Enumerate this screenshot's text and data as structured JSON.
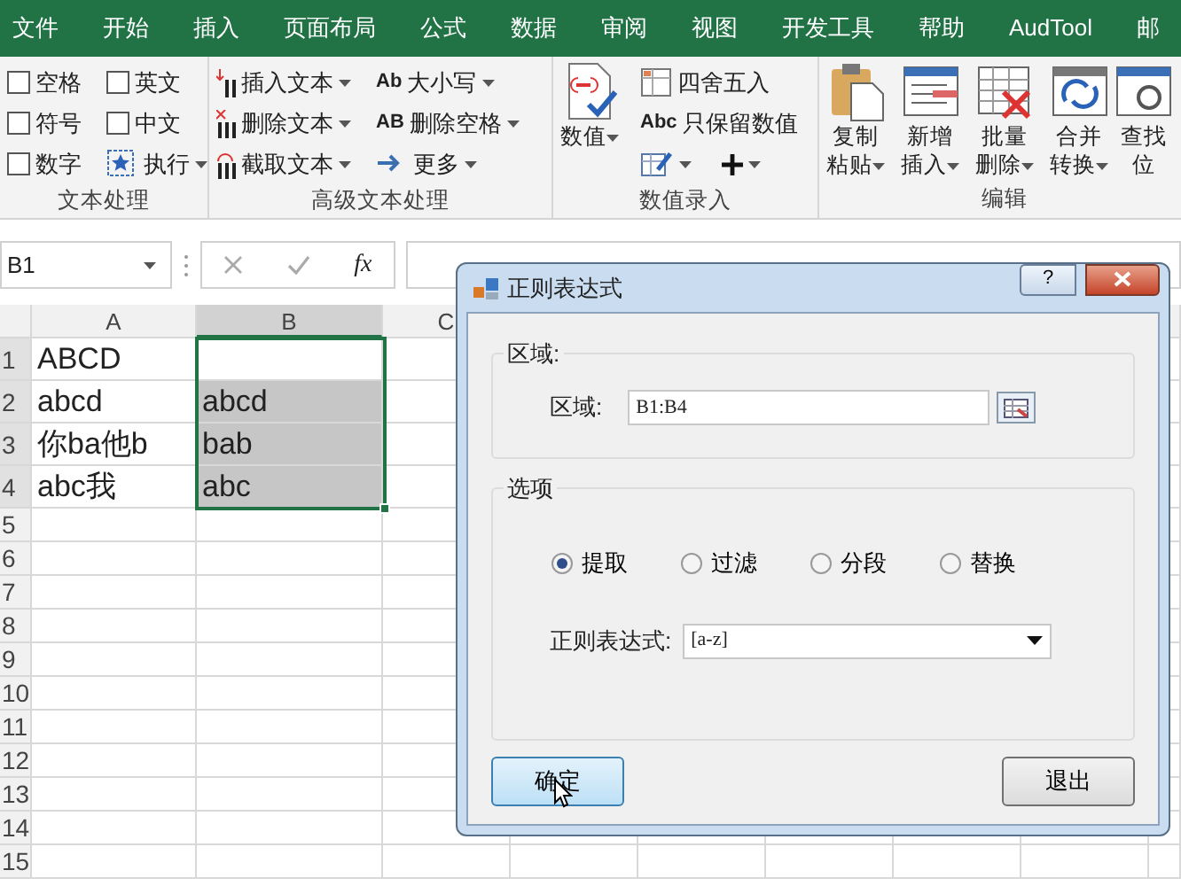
{
  "menu_tabs": [
    {
      "label": "文件"
    },
    {
      "label": "开始"
    },
    {
      "label": "插入"
    },
    {
      "label": "页面布局"
    },
    {
      "label": "公式"
    },
    {
      "label": "数据"
    },
    {
      "label": "审阅"
    },
    {
      "label": "视图"
    },
    {
      "label": "开发工具"
    },
    {
      "label": "帮助"
    },
    {
      "label": "AudTool"
    },
    {
      "label": "邮"
    }
  ],
  "ribbon": {
    "groups": [
      {
        "title": "文本处理",
        "items": [
          {
            "kind": "checkbox",
            "label": "空格",
            "checked": false
          },
          {
            "kind": "checkbox",
            "label": "符号",
            "checked": false
          },
          {
            "kind": "checkbox",
            "label": "数字",
            "checked": false
          },
          {
            "kind": "checkbox",
            "label": "英文",
            "checked": false
          },
          {
            "kind": "checkbox",
            "label": "中文",
            "checked": false
          },
          {
            "kind": "small",
            "label": "执行",
            "dropdown": true
          }
        ]
      },
      {
        "title": "高级文本处理",
        "items": [
          {
            "kind": "small",
            "label": "插入文本",
            "dropdown": true
          },
          {
            "kind": "small",
            "label": "删除文本",
            "dropdown": true
          },
          {
            "kind": "small",
            "label": "截取文本",
            "dropdown": true
          },
          {
            "kind": "small",
            "glyph": "Ab",
            "label": "大小写",
            "dropdown": true
          },
          {
            "kind": "small",
            "glyph": "AB",
            "label": "删除空格",
            "dropdown": true
          },
          {
            "kind": "small",
            "label": "更多",
            "dropdown": true
          }
        ]
      },
      {
        "title": "数值录入",
        "items": [
          {
            "kind": "large",
            "label": "数值",
            "dropdown": true
          },
          {
            "kind": "small",
            "label": "四舍五入",
            "dropdown": false
          },
          {
            "kind": "small",
            "glyph": "Abc",
            "label": "只保留数值",
            "dropdown": false
          },
          {
            "kind": "icon",
            "dropdown": true
          },
          {
            "kind": "icon",
            "dropdown": true
          }
        ]
      },
      {
        "title": "编辑",
        "items": [
          {
            "kind": "large",
            "label": "复制粘贴",
            "dropdown": true
          },
          {
            "kind": "large",
            "label": "新增插入",
            "dropdown": true
          },
          {
            "kind": "large",
            "label": "批量删除",
            "dropdown": true
          },
          {
            "kind": "large",
            "label": "合并转换",
            "dropdown": true
          },
          {
            "kind": "large",
            "label": "查找位",
            "dropdown": false
          }
        ]
      }
    ]
  },
  "formula_bar": {
    "name_box": "B1",
    "fx": "fx"
  },
  "sheet": {
    "columns": [
      {
        "label": "A",
        "selected": false
      },
      {
        "label": "B",
        "selected": true
      },
      {
        "label": "C",
        "selected": false
      }
    ],
    "rows": [
      {
        "label": "1",
        "selected": true,
        "cells": [
          {
            "text": "ABCD",
            "selected": false
          },
          {
            "text": "",
            "selected": false
          }
        ]
      },
      {
        "label": "2",
        "selected": true,
        "cells": [
          {
            "text": "abcd",
            "selected": false
          },
          {
            "text": "abcd",
            "selected": true
          }
        ]
      },
      {
        "label": "3",
        "selected": true,
        "cells": [
          {
            "text": "你ba他b",
            "selected": false
          },
          {
            "text": "bab",
            "selected": true
          }
        ]
      },
      {
        "label": "4",
        "selected": true,
        "cells": [
          {
            "text": "abc我",
            "selected": false
          },
          {
            "text": "abc",
            "selected": true
          }
        ]
      },
      {
        "label": "5",
        "selected": false,
        "cells": []
      },
      {
        "label": "6",
        "selected": false,
        "cells": []
      },
      {
        "label": "7",
        "selected": false,
        "cells": []
      },
      {
        "label": "8",
        "selected": false,
        "cells": []
      },
      {
        "label": "9",
        "selected": false,
        "cells": []
      },
      {
        "label": "10",
        "selected": false,
        "cells": []
      },
      {
        "label": "11",
        "selected": false,
        "cells": []
      },
      {
        "label": "12",
        "selected": false,
        "cells": []
      },
      {
        "label": "13",
        "selected": false,
        "cells": []
      },
      {
        "label": "14",
        "selected": false,
        "cells": []
      },
      {
        "label": "15",
        "selected": false,
        "cells": []
      }
    ]
  },
  "dialog": {
    "title": "正则表达式",
    "help": "?",
    "range_group": {
      "title": "区域:",
      "label": "区域:",
      "value": "B1:B4"
    },
    "options_group": {
      "title": "选项",
      "modes": [
        {
          "label": "提取",
          "selected": true
        },
        {
          "label": "过滤",
          "selected": false
        },
        {
          "label": "分段",
          "selected": false
        },
        {
          "label": "替换",
          "selected": false
        }
      ],
      "regex_label": "正则表达式:",
      "regex_value": "[a-z]"
    },
    "buttons": [
      {
        "label": "确定",
        "hovered": true
      },
      {
        "label": "退出",
        "hovered": false
      }
    ]
  }
}
